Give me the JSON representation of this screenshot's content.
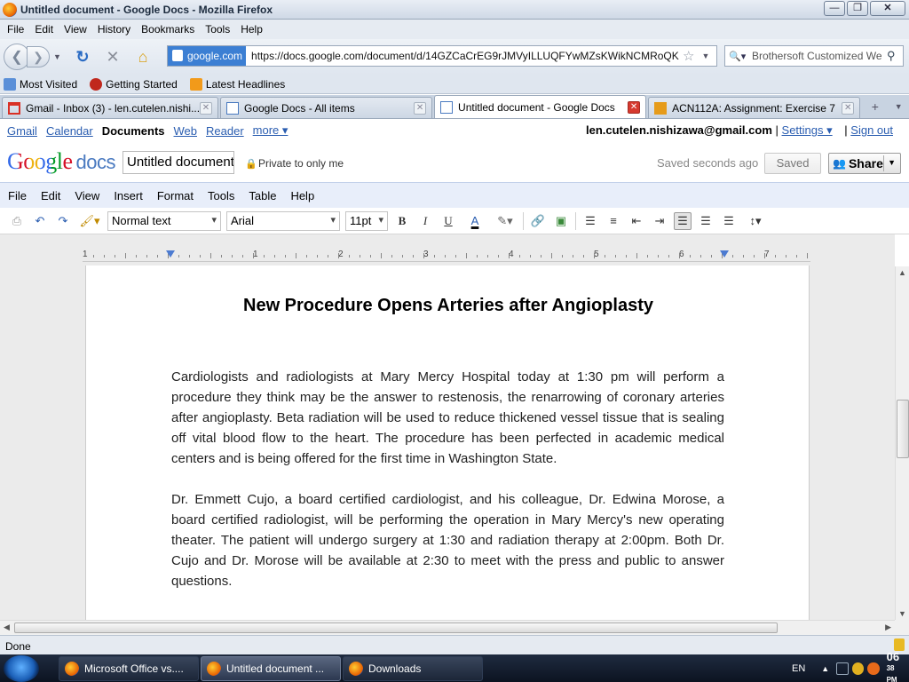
{
  "window": {
    "title": "Untitled document - Google Docs - Mozilla Firefox",
    "minimize": "—",
    "maximize": "❐",
    "close": "✕"
  },
  "menubar": [
    "File",
    "Edit",
    "View",
    "History",
    "Bookmarks",
    "Tools",
    "Help"
  ],
  "navbar": {
    "url_badge": "google.com",
    "url": "https://docs.google.com/document/d/14GZCaCrEG9rJMVyILLUQFYwMZsKWikNCMRoQKEgROv",
    "search_text": "Brothersoft Customized We"
  },
  "bookmarks": [
    "Most Visited",
    "Getting Started",
    "Latest Headlines"
  ],
  "tabs": [
    {
      "label": "Gmail - Inbox (3) - len.cutelen.nishi...",
      "icon_color": "#d93025"
    },
    {
      "label": "Google Docs - All items",
      "icon_color": "#4a7ac0"
    },
    {
      "label": "Untitled document - Google Docs",
      "icon_color": "#4a7ac0"
    },
    {
      "label": "ACN112A: Assignment: Exercise 7",
      "icon_color": "#e69b1a"
    }
  ],
  "gbar": {
    "links": [
      "Gmail",
      "Calendar",
      "Documents",
      "Web",
      "Reader",
      "more ▾"
    ],
    "email": "len.cutelen.nishizawa@gmail.com",
    "separator": "|",
    "settings": "Settings ▾",
    "signout": "Sign out"
  },
  "docs_header": {
    "logo_g": "Google",
    "logo_docs": "docs",
    "doc_title": "Untitled document",
    "private": "Private to only me",
    "saved_note": "Saved seconds ago",
    "saved_button": "Saved",
    "share_button": "Share"
  },
  "docs_menu": [
    "File",
    "Edit",
    "View",
    "Insert",
    "Format",
    "Tools",
    "Table",
    "Help"
  ],
  "toolbar": {
    "style": "Normal text",
    "font": "Arial",
    "size": "11pt",
    "bold": "B",
    "italic": "I",
    "underline": "U",
    "text_color": "A"
  },
  "ruler_numbers": [
    "1",
    "1",
    "2",
    "3",
    "4",
    "5",
    "6",
    "7"
  ],
  "document": {
    "heading": "New Procedure Opens Arteries after Angioplasty",
    "paragraph1": "Cardiologists and radiologists at Mary Mercy Hospital today at 1:30 pm will perform a procedure they think may be the answer to restenosis, the renarrowing of coronary arteries after angioplasty. Beta radiation will be used to reduce thickened vessel tissue that is sealing off vital blood flow to the heart. The procedure has been perfected in academic medical centers and is being offered for the first time in Washington State.",
    "paragraph2": "Dr. Emmett Cujo, a board certified cardiologist, and his colleague, Dr. Edwina Morose, a board certified radiologist, will be performing the operation in Mary Mercy's new operating theater. The patient will undergo surgery at 1:30 and radiation therapy at 2:00pm. Both Dr. Cujo and Dr. Morose will be available at 2:30 to meet with the press and public to answer questions."
  },
  "status": "Done",
  "taskbar": {
    "items": [
      "Microsoft Office vs....",
      "Untitled document ...",
      "Downloads"
    ],
    "lang": "EN",
    "time": "06",
    "time2": "38",
    "ampm": "PM"
  }
}
